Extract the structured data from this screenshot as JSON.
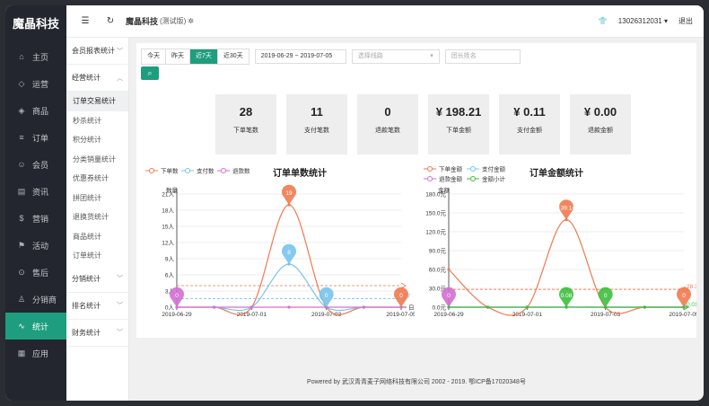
{
  "brand": "魔晶科技",
  "sidebar": [
    {
      "label": "主页",
      "icon": "home-icon",
      "glyph": "⌂"
    },
    {
      "label": "运营",
      "icon": "shield-icon",
      "glyph": "◇"
    },
    {
      "label": "商品",
      "icon": "tag-icon",
      "glyph": "◈"
    },
    {
      "label": "订单",
      "icon": "list-icon",
      "glyph": "≡"
    },
    {
      "label": "会员",
      "icon": "user-icon",
      "glyph": "☺"
    },
    {
      "label": "资讯",
      "icon": "document-icon",
      "glyph": "▤"
    },
    {
      "label": "营销",
      "icon": "money-icon",
      "glyph": "$"
    },
    {
      "label": "活动",
      "icon": "flag-icon",
      "glyph": "⚑"
    },
    {
      "label": "售后",
      "icon": "return-icon",
      "glyph": "⊙"
    },
    {
      "label": "分销商",
      "icon": "person-icon",
      "glyph": "♙"
    },
    {
      "label": "统计",
      "icon": "chart-line-icon",
      "glyph": "∿",
      "active": true
    },
    {
      "label": "应用",
      "icon": "grid-icon",
      "glyph": "▦"
    }
  ],
  "topbar": {
    "title": "魔晶科技",
    "tag": "(测试版)",
    "phone": "13026312031",
    "logout": "退出"
  },
  "subnav": {
    "groups": [
      {
        "label": "会员报表统计",
        "items": []
      },
      {
        "label": "经营统计",
        "items": [
          "订单交易统计",
          "秒杀统计",
          "积分统计",
          "分类销量统计",
          "优惠券统计",
          "拼团统计",
          "退换货统计",
          "商品统计",
          "订单统计"
        ]
      },
      {
        "label": "分销统计",
        "items": []
      },
      {
        "label": "排名统计",
        "items": []
      },
      {
        "label": "财务统计",
        "items": []
      }
    ]
  },
  "filters": {
    "ranges": [
      "今天",
      "昨天",
      "近7天",
      "近30天"
    ],
    "active_range": "近7天",
    "date_range": "2019-06-29 ~ 2019-07-05",
    "route_placeholder": "选择线路",
    "leader_placeholder": "团长姓名"
  },
  "stats": [
    {
      "value": "28",
      "label": "下单笔数"
    },
    {
      "value": "11",
      "label": "支付笔数"
    },
    {
      "value": "0",
      "label": "退款笔数"
    },
    {
      "value": "¥ 198.21",
      "label": "下单金额"
    },
    {
      "value": "¥ 0.11",
      "label": "支付金额"
    },
    {
      "value": "¥ 0.00",
      "label": "退款金额"
    }
  ],
  "chart_data": [
    {
      "type": "line",
      "title": "订单单数统计",
      "ylabel": "数量",
      "xlabel": "日期",
      "x": [
        "2019-06-29",
        "2019-06-30",
        "2019-07-01",
        "2019-07-02",
        "2019-07-03",
        "2019-07-04",
        "2019-07-05"
      ],
      "x_ticks": [
        "2019-06-29",
        "2019-07-01",
        "2019-07-03",
        "2019-07-05"
      ],
      "y_ticks": [
        0,
        3,
        6,
        9,
        12,
        15,
        18,
        21
      ],
      "ylim": [
        0,
        21
      ],
      "series": [
        {
          "name": "下单数",
          "color": "#f07a50",
          "values": [
            0,
            0,
            0,
            19,
            0,
            0,
            0
          ],
          "label": "19",
          "label_index": 3
        },
        {
          "name": "支付数",
          "color": "#78c4ec",
          "values": [
            0,
            0,
            0,
            8,
            0,
            0,
            0
          ],
          "label": "8",
          "label_index": 3
        },
        {
          "name": "退款数",
          "color": "#d36fd2",
          "values": [
            0,
            0,
            0,
            0,
            0,
            0,
            0
          ],
          "label": "0",
          "label_index": 0
        }
      ],
      "avg_lines": [
        {
          "value": 4,
          "color": "#f07a50"
        },
        {
          "value": 1.57,
          "color": "#78c4ec",
          "text": "57"
        }
      ],
      "extra_labels": [
        {
          "series": 1,
          "index": 4,
          "text": "0"
        },
        {
          "series": 0,
          "index": 6,
          "text": "0"
        }
      ]
    },
    {
      "type": "line",
      "title": "订单金额统计",
      "ylabel": "金额",
      "x": [
        "2019-06-29",
        "2019-06-30",
        "2019-07-01",
        "2019-07-02",
        "2019-07-03",
        "2019-07-04",
        "2019-07-05"
      ],
      "x_ticks": [
        "2019-06-29",
        "2019-07-01",
        "2019-07-03",
        "2019-07-05"
      ],
      "y_ticks": [
        0,
        30,
        60,
        90,
        120,
        150,
        180
      ],
      "ylim": [
        0,
        180
      ],
      "series": [
        {
          "name": "下单金额",
          "color": "#f07a50",
          "values": [
            60,
            0,
            0,
            139.14,
            0,
            0,
            0
          ],
          "label": "139.14",
          "label_index": 3
        },
        {
          "name": "支付金额",
          "color": "#78c4ec",
          "values": [
            0,
            0,
            0,
            0,
            0,
            0,
            0
          ]
        },
        {
          "name": "退款金额",
          "color": "#d36fd2",
          "values": [
            0,
            0,
            0,
            0,
            0,
            0,
            0
          ],
          "label": "0",
          "label_index": 0
        },
        {
          "name": "金额小计",
          "color": "#3cbf3c",
          "values": [
            0,
            0,
            0,
            0.08,
            0,
            0,
            0
          ],
          "label": "0.08",
          "label_index": 3
        }
      ],
      "avg_lines": [
        {
          "value": 28.32,
          "color": "#f07a50",
          "text": "28.32"
        },
        {
          "value": 0.01,
          "color": "#3cbf3c",
          "text": "0.01"
        }
      ],
      "extra_labels": [
        {
          "series": 3,
          "index": 4,
          "text": "0"
        },
        {
          "series": 0,
          "index": 6,
          "text": "0"
        }
      ]
    }
  ],
  "footer": "Powered by 武汉青青麦子网络科技有限公司 2002 - 2019. 鄂ICP备17020348号"
}
